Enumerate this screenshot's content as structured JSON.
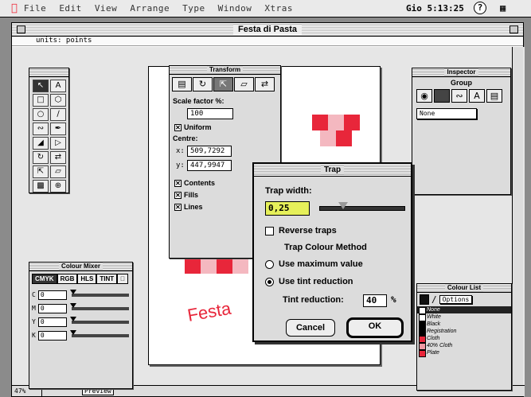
{
  "menubar": {
    "items": [
      "File",
      "Edit",
      "View",
      "Arrange",
      "Type",
      "Window",
      "Xtras"
    ],
    "clock": "Gio 5:13:25",
    "help": "?"
  },
  "document": {
    "title": "Festa di Pasta",
    "units_label": "units: points",
    "zoom": "47%",
    "view_mode": "Preview",
    "artwork_text": "Festa"
  },
  "transform": {
    "title": "Transform",
    "scale_label": "Scale factor %:",
    "scale_value": "100",
    "uniform_label": "Uniform",
    "centre_label": "Centre:",
    "x_label": "x:",
    "x_value": "509,7292",
    "y_label": "y:",
    "y_value": "447,9947",
    "contents_label": "Contents",
    "fills_label": "Fills",
    "lines_label": "Lines"
  },
  "inspector": {
    "title": "Inspector",
    "subtitle": "Group",
    "dropdown": "None"
  },
  "colour_mixer": {
    "title": "Colour Mixer",
    "tabs": [
      "CMYK",
      "RGB",
      "HLS",
      "TINT"
    ],
    "rows": [
      {
        "label": "C",
        "value": "0"
      },
      {
        "label": "M",
        "value": "0"
      },
      {
        "label": "Y",
        "value": "0"
      },
      {
        "label": "K",
        "value": "0"
      }
    ]
  },
  "colour_list": {
    "title": "Colour List",
    "options_label": "Options",
    "items": [
      {
        "name": "None",
        "color": "#ffffff"
      },
      {
        "name": "White",
        "color": "#ffffff"
      },
      {
        "name": "Black",
        "color": "#000000"
      },
      {
        "name": "Registration",
        "color": "#000000"
      },
      {
        "name": "Cloth",
        "color": "#e8263a"
      },
      {
        "name": "40% Cloth",
        "color": "#f19aa4"
      },
      {
        "name": "Plate",
        "color": "#e8263a"
      }
    ]
  },
  "trap": {
    "title": "Trap",
    "width_label": "Trap width:",
    "width_value": "0,25",
    "width_slider_fraction": 0.27,
    "reverse_label": "Reverse traps",
    "method_heading": "Trap Colour Method",
    "option_max": "Use maximum value",
    "option_tint": "Use tint reduction",
    "tint_label": "Tint reduction:",
    "tint_value": "40",
    "percent": "%",
    "cancel_label": "Cancel",
    "ok_label": "OK"
  },
  "colors": {
    "accent_red": "#e8263a",
    "field_highlight": "#e6f05a"
  }
}
